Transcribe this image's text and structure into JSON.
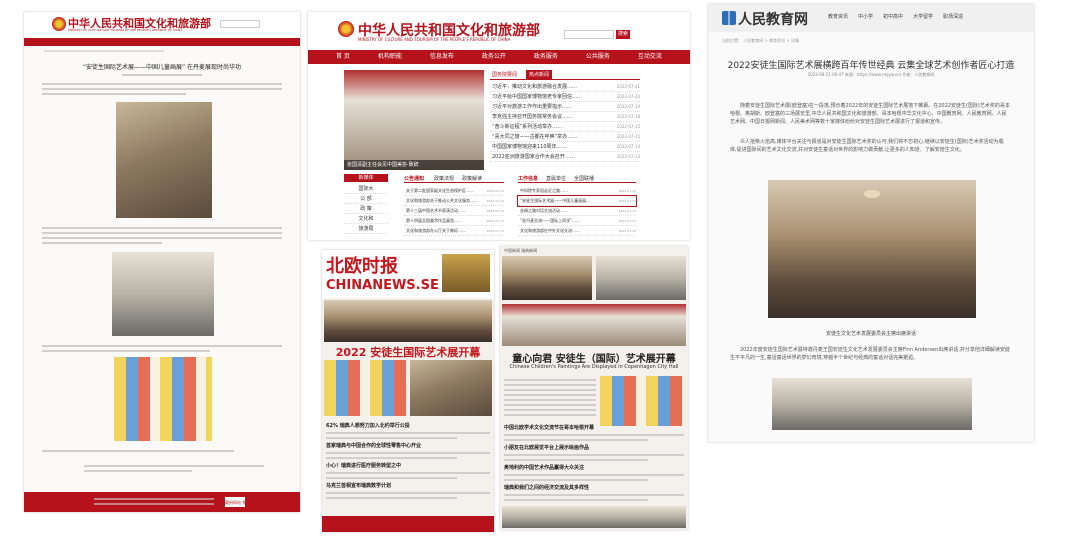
{
  "panel1": {
    "site_title": "中华人民共和国文化和旅游部",
    "site_subtitle": "MINISTRY OF CULTURE AND TOURISM OF THE PEOPLE'S REPUBLIC OF CHINA",
    "article_title": "“安徒生国际艺术展——中国儿童画展” 在丹麦展现时尚华功",
    "footer_badge": "政府网站 找错"
  },
  "panel2": {
    "site_title": "中华人民共和国文化和旅游部",
    "site_subtitle": "MINISTRY OF CULTURE AND TOURISM OF THE PEOPLE'S REPUBLIC OF CHINA",
    "search_button": "搜索",
    "nav": [
      "首 页",
      "机构职能",
      "信息发布",
      "政务公开",
      "政务服务",
      "公共服务",
      "互动交流"
    ],
    "news_tabs": [
      "国务院要闻",
      "热点新闻"
    ],
    "hero_caption": "张国清副主任会见中国美协·致辞",
    "hot_news": [
      {
        "title": "习近平：推动文化和旅游融合发展……",
        "date": "2022-07-21"
      },
      {
        "title": "习近平给中国国家博物馆老专家回信……",
        "date": "2022-07-20"
      },
      {
        "title": "习近平对旅游工作作出重要指示……",
        "date": "2022-07-19"
      },
      {
        "title": "李克强主持召开国务院常务会议……",
        "date": "2022-07-18"
      },
      {
        "title": "“奋斗新征程”系列活动举办……",
        "date": "2022-07-15"
      },
      {
        "title": "“喜大同之旅——古都在呼唤”举办……",
        "date": "2022-07-15"
      },
      {
        "title": "中国国家博物馆迎来110周年……",
        "date": "2022-07-14"
      },
      {
        "title": "2022亚洲旅游国家合作大会召开……",
        "date": "2022-07-13"
      }
    ],
    "side_label": "新媒体",
    "side_items": [
      "国际大",
      "公 部",
      "政 策",
      "文化和",
      "旅游局"
    ],
    "tabs_left": [
      "公告通知",
      "政策法规",
      "政策解读"
    ],
    "tabs_right": [
      "工作信息",
      "直属单位",
      "全国联播"
    ],
    "left_list": [
      {
        "title": "关于第二批国家级文化生态保护区……",
        "date": "2022-07-15"
      },
      {
        "title": "文化和旅游部关于推动公共文化服务……",
        "date": "2022-07-14"
      },
      {
        "title": "第十三届中国艺术节表演活动……",
        "date": "2022-07-13"
      },
      {
        "title": "第十四届全国美术作品展览……",
        "date": "2022-07-12"
      },
      {
        "title": "文化和旅游部办公厅关于做好……",
        "date": "2022-07-11"
      }
    ],
    "right_list": [
      {
        "title": "中科院专家组走近之路……",
        "date": "2022-07-15"
      },
      {
        "title": "“安徒生国际艺术展——中国儿童画展…",
        "date": "2022-07-15",
        "highlight": true
      },
      {
        "title": "丝绸之路对话交流活动……",
        "date": "2022-07-14"
      },
      {
        "title": "“驻丹麦交流——国际上同学”……",
        "date": "2022-07-13"
      },
      {
        "title": "文化和旅游部在中外文化交流……",
        "date": "2022-07-12"
      }
    ]
  },
  "panel3": {
    "logo_text": "人民教育网",
    "nav": [
      "教育资讯",
      "中小学",
      "初中高中",
      "大学留学",
      "职场深造"
    ],
    "breadcrumb": "当前位置： 人民教育网 > 教育资讯 > 详情",
    "title": "2022安徒生国际艺术展横跨百年传世经典 云集全球艺术创作者匠心打造",
    "meta": "2022-08-21 00:47    来源：https://www.rmjyw.cn/ 作者：人民教育网",
    "para1": "随着安徒生国际艺术展(欧登塞)在一段落,预示着2022年的安徒生国际艺术展落下帷幕。在2022安徒生(国际)艺术奖的哥本哈根、奥胡斯、欧登塞的三场展览里,中华人民共和国文化和旅游部、哥本哈根中华文化中心、中国教育网、人民教育网、人民艺术网、中国日报网新闻、人民美术网等数十家媒体纷纷对安徒生国际艺术展进行了报道和宣传。",
    "para2": "众人拾柴火焰高,媒体平台关注与报道是对安徒生国际艺术奖的认可,我们将不忘初心,继续以安徒生(国际)艺术奖活动为载体,促进国际间的艺术文化交流,并对安徒生童话对世界的影响力做贡献,让更多的人知道、了解安徒生文化。",
    "caption": "安徒生文化艺术发展委员会主席出席讲话",
    "para3": "2022年度安徒生国际艺术展特邀丹麦王国安徒生文化艺术发展委员会主席Finn Andersen出席讲话,并分享他详细解读安徒生不平凡的一生,童话童话世界的梦幻奇境,穿越半个世纪与经典的童话对话完美邂逅。"
  },
  "panel4": {
    "masthead": "北欧时报",
    "masthead_en": "CHINANEWS.SE",
    "headline": "2022 安徒生国际艺术展开幕",
    "sub_items": [
      "62% 瑞典人想努力加入北约举行公投",
      "首家瑞典与中国合作的全球性零售中心开业",
      "小心！瑞典进行医疗服务转型之中",
      "马克兰首相宣布瑞典数学计划"
    ]
  },
  "panel5": {
    "page_tag": "中国新闻  瑞典新闻",
    "headline": "童心向君 安徒生（国际）艺术展开幕",
    "headline_en": "Chinese Children's Paintings Are Displayed in Copenhagen City Hall",
    "sub_items": [
      "中国北欧学术文化交流节在哥本哈根开幕",
      "小朋友在北欧展览平台上展示绘画作品",
      "奥地利的中国艺术作品赢得大众关注",
      "瑞典和我们之间的经济交流及其多样性"
    ]
  }
}
